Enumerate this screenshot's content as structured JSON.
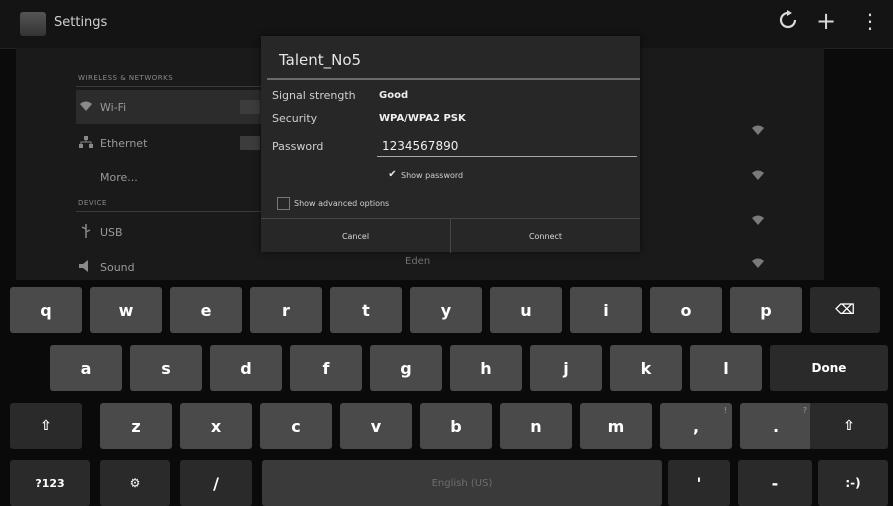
{
  "action_bar": {
    "title": "Settings",
    "icons": [
      "refresh-icon",
      "add-icon",
      "overflow-icon"
    ],
    "add_glyph": "+",
    "overflow_glyph": "⋮"
  },
  "settings": {
    "wireless_header": "WIRELESS & NETWORKS",
    "device_header": "DEVICE",
    "items": [
      {
        "label": "Wi-Fi"
      },
      {
        "label": "Ethernet"
      },
      {
        "label": "More..."
      },
      {
        "label": "USB"
      },
      {
        "label": "Sound"
      }
    ],
    "network_fragment": "Eden"
  },
  "dialog": {
    "title": "Talent_No5",
    "signal_label": "Signal strength",
    "signal_value": "Good",
    "security_label": "Security",
    "security_value": "WPA/WPA2 PSK",
    "password_label": "Password",
    "password_value": "1234567890",
    "show_password_label": "Show password",
    "show_password_checked": true,
    "advanced_label": "Show advanced options",
    "advanced_checked": false,
    "cancel_label": "Cancel",
    "connect_label": "Connect"
  },
  "keyboard": {
    "row1": [
      "q",
      "w",
      "e",
      "r",
      "t",
      "y",
      "u",
      "i",
      "o",
      "p"
    ],
    "backspace_glyph": "⌫",
    "row2": [
      "a",
      "s",
      "d",
      "f",
      "g",
      "h",
      "j",
      "k",
      "l"
    ],
    "done_label": "Done",
    "shift_glyph": "⇧",
    "row3": [
      "z",
      "x",
      "c",
      "v",
      "b",
      "n",
      "m",
      ",",
      "."
    ],
    "row3_hints": [
      "",
      "",
      "",
      "",
      "",
      "",
      "",
      "!",
      "?"
    ],
    "symbols_label": "?123",
    "settings_glyph": "⚙",
    "slash_label": "/",
    "space_label": "English (US)",
    "apostrophe_label": "'",
    "dash_label": "-",
    "smiley_label": ":-)"
  }
}
